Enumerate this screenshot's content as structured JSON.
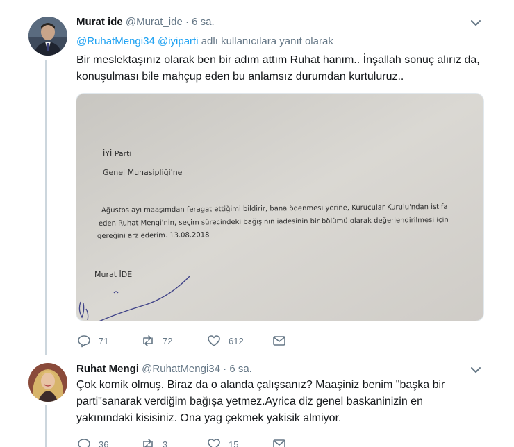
{
  "tweets": [
    {
      "author": "Murat ide",
      "handle": "@Murat_ide",
      "separator": "·",
      "time": "6 sa.",
      "reply_to": {
        "mention1": "@RuhatMengi34",
        "mention2": "@iyiparti",
        "suffix": "adlı kullanıcılara yanıt olarak"
      },
      "text": "Bir meslektaşınız olarak ben bir adım attım Ruhat hanım.. İnşallah sonuç alırız da, konuşulması bile mahçup eden bu anlamsız durumdan kurtuluruz..",
      "document": {
        "line1": "İYİ Parti",
        "line2": "Genel Muhasipliği'ne",
        "body1": "Ağustos ayı maaşımdan feragat ettiğimi bildirir, bana ödenmesi yerine, Kurucular Kurulu'ndan istifa",
        "body2": "eden Ruhat Mengi'nin, seçim sürecindeki bağışının iadesinin bir bölümü olarak değerlendirilmesi için",
        "body3": "gereğini arz ederim. 13.08.2018",
        "signature_name": "Murat İDE"
      },
      "replies": "71",
      "retweets": "72",
      "likes": "612"
    },
    {
      "author": "Ruhat Mengi",
      "handle": "@RuhatMengi34",
      "separator": "·",
      "time": "6 sa.",
      "text": "Çok komik olmuş. Biraz da o alanda çalışsanız? Maaşiniz benim \"başka bir parti\"sanarak verdiğim bağışa yetmez.Ayrica diz genel baskaninizin en yakınındaki kisisiniz. Ona yag çekmek yakisik almiyor.",
      "replies": "36",
      "retweets": "3",
      "likes": "15"
    }
  ],
  "colors": {
    "accent": "#1da1f2",
    "secondary_text": "#657786",
    "thread_line": "#ccd6dd"
  }
}
